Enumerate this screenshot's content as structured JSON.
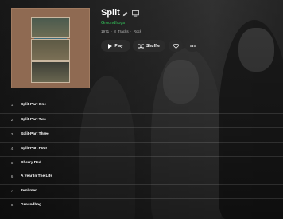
{
  "album": {
    "title": "Split",
    "artist": "Groundhogs",
    "meta": "1971 · 8 Tracks · Rock"
  },
  "actions": {
    "play_label": "Play",
    "shuffle_label": "Shuffle"
  },
  "icons": {
    "edit": "pencil-icon",
    "mini_player": "screen-icon",
    "play": "play-icon",
    "shuffle": "shuffle-icon",
    "favorite": "heart-icon",
    "more": "more-icon"
  },
  "colors": {
    "accent": "#33c55a",
    "button_bg": "#2b2b2b"
  },
  "tracks": [
    {
      "num": "1",
      "name": "Split-Part One"
    },
    {
      "num": "2",
      "name": "Split-Part Two"
    },
    {
      "num": "3",
      "name": "Split-Part Three"
    },
    {
      "num": "4",
      "name": "Split-Part Four"
    },
    {
      "num": "5",
      "name": "Cherry Red"
    },
    {
      "num": "6",
      "name": "A Year In The Life"
    },
    {
      "num": "7",
      "name": "Junkman"
    },
    {
      "num": "8",
      "name": "Groundhog"
    }
  ]
}
